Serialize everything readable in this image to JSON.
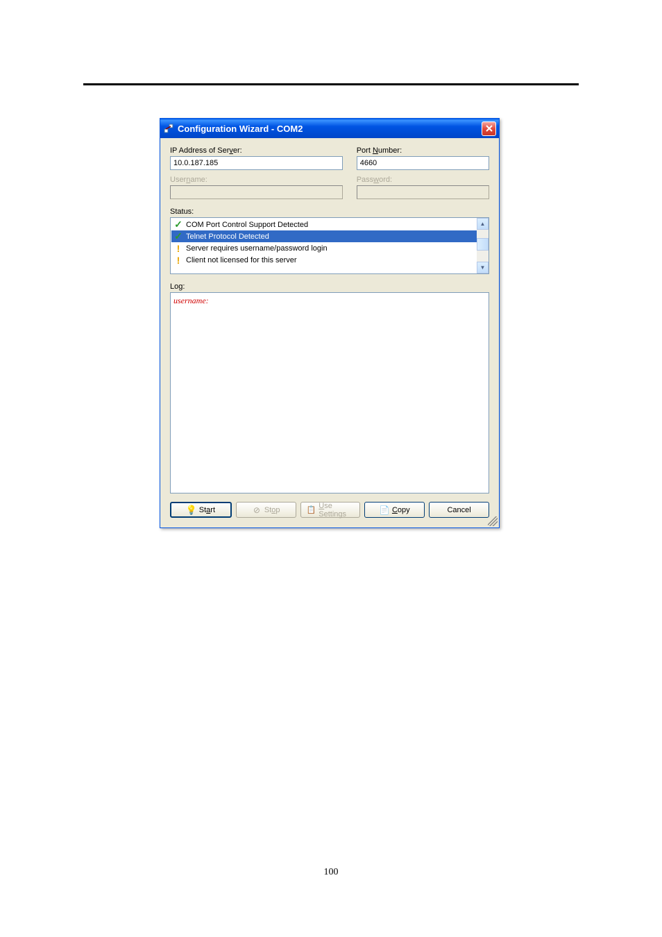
{
  "titlebar": {
    "title": "Configuration Wizard - COM2"
  },
  "form": {
    "ip_label_prefix": "IP Address of Ser",
    "ip_label_u": "v",
    "ip_label_suffix": "er:",
    "ip_value": "10.0.187.185",
    "port_label_prefix": "Port ",
    "port_label_u": "N",
    "port_label_suffix": "umber:",
    "port_value": "4660",
    "username_label_prefix": "User",
    "username_label_u": "n",
    "username_label_suffix": "ame:",
    "username_value": "",
    "password_label_prefix": "Pass",
    "password_label_u": "w",
    "password_label_suffix": "ord:",
    "password_value": ""
  },
  "status": {
    "label": "Status:",
    "items": [
      {
        "icon": "check",
        "text": "COM Port Control Support Detected",
        "selected": false
      },
      {
        "icon": "check",
        "text": "Telnet Protocol Detected",
        "selected": true
      },
      {
        "icon": "warn",
        "text": "Server requires username/password login",
        "selected": false
      },
      {
        "icon": "warn",
        "text": "Client not licensed for this server",
        "selected": false
      }
    ]
  },
  "log": {
    "label": "Log:",
    "content": "username:"
  },
  "buttons": {
    "start_prefix": " St",
    "start_u": "a",
    "start_suffix": "rt",
    "stop_prefix": " St",
    "stop_u": "o",
    "stop_suffix": "p",
    "use_prefix": " ",
    "use_u": "U",
    "use_suffix": "se Settings",
    "copy_prefix": " ",
    "copy_u": "C",
    "copy_suffix": "opy",
    "cancel": "Cancel"
  },
  "page_number": "100"
}
